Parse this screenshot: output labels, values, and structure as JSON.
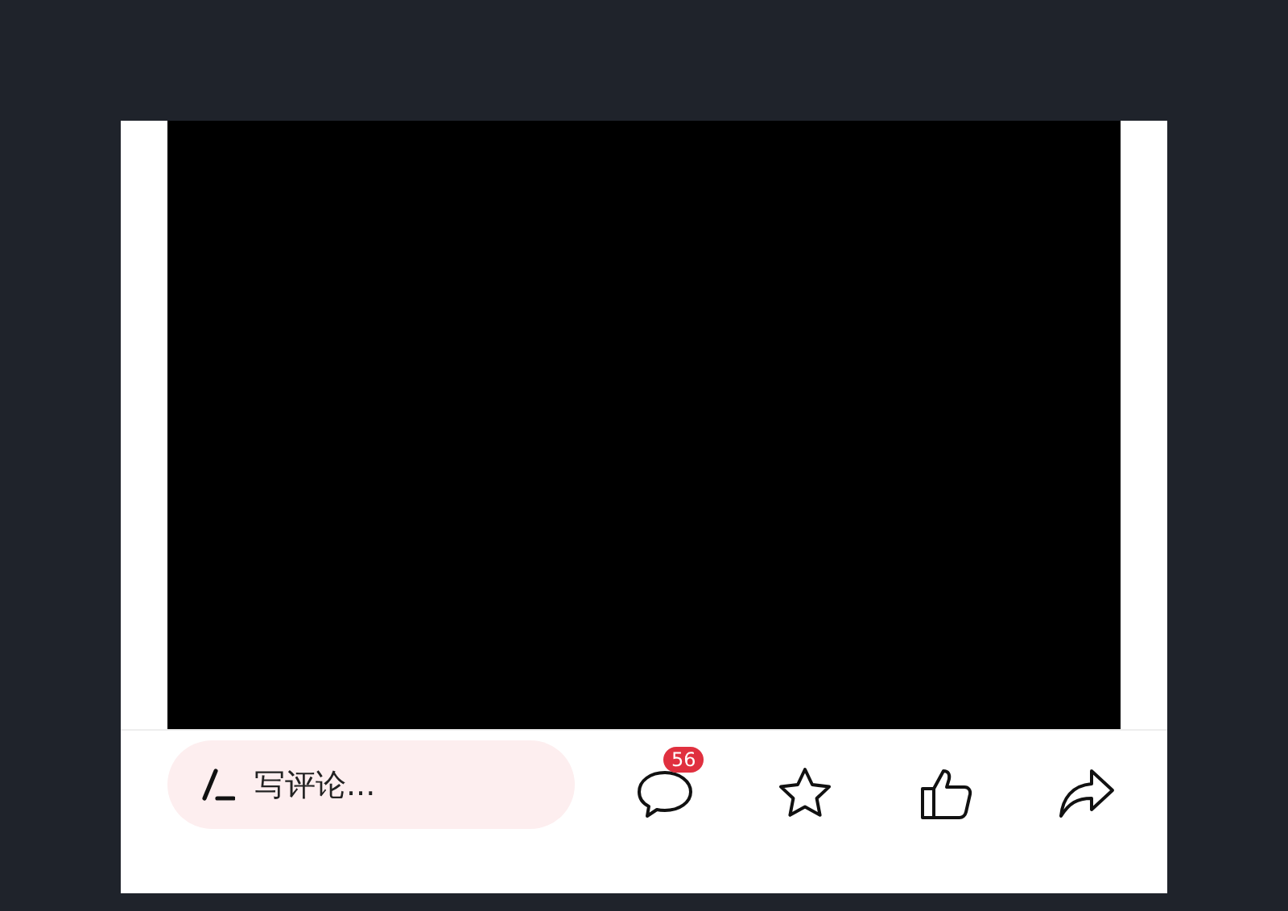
{
  "comment_field": {
    "placeholder": "写评论..."
  },
  "actions": [
    {
      "kind": "comment",
      "badge": "56"
    },
    {
      "kind": "star"
    },
    {
      "kind": "like"
    },
    {
      "kind": "share"
    }
  ]
}
